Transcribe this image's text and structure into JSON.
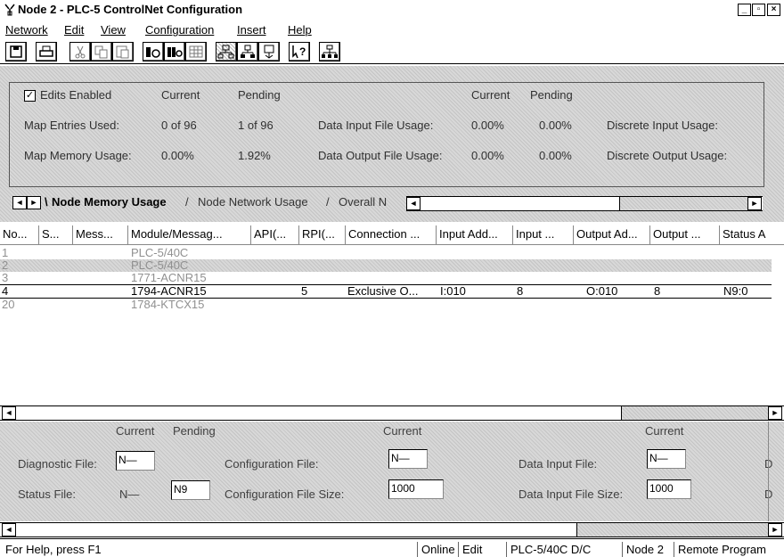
{
  "window": {
    "title": "Node 2 - PLC-5 ControlNet Configuration",
    "minimize_glyph": "_",
    "maximize_glyph": "▫",
    "close_glyph": "×"
  },
  "menu": [
    "Network",
    "Edit",
    "View",
    "Configuration",
    "Insert",
    "Help"
  ],
  "toolbar_icons": [
    "save-icon",
    "print-icon",
    "cut-icon",
    "copy-icon",
    "paste-icon",
    "io-icon",
    "multi-io-icon",
    "grid-icon",
    "network-tree-icon",
    "hierarchy-icon",
    "transfer-icon",
    "help-icon",
    "network-icon"
  ],
  "summary": {
    "edits_enabled_label": "Edits Enabled",
    "edits_enabled_checked": true,
    "checkbox_mark": "✓",
    "col_current": "Current",
    "col_pending": "Pending",
    "col_current2": "Current",
    "col_pending2": "Pending",
    "map_entries_label": "Map Entries Used:",
    "map_entries_current": "0 of 96",
    "map_entries_pending": "1 of 96",
    "map_memory_label": "Map Memory Usage:",
    "map_memory_current": "0.00%",
    "map_memory_pending": "1.92%",
    "data_input_label": "Data Input File Usage:",
    "data_input_current": "0.00%",
    "data_input_pending": "0.00%",
    "data_output_label": "Data Output File Usage:",
    "data_output_current": "0.00%",
    "data_output_pending": "0.00%",
    "discrete_input_label": "Discrete Input Usage:",
    "discrete_output_label": "Discrete Output Usage:"
  },
  "tabs": [
    "Node Memory Usage",
    "Node Network Usage",
    "Overall N"
  ],
  "scroll_glyphs": {
    "left": "◄",
    "right": "►"
  },
  "grid": {
    "columns": [
      "No...",
      "S...",
      "Mess...",
      "Module/Messag...",
      "API(...",
      "RPI(...",
      "Connection ...",
      "Input Add...",
      "Input ...",
      "Output Ad...",
      "Output ...",
      "Status A"
    ],
    "rows": [
      {
        "no": "1",
        "module": "PLC-5/40C",
        "rpi": "",
        "connection": "",
        "input_addr": "",
        "input_size": "",
        "output_addr": "",
        "output_size": "",
        "status": ""
      },
      {
        "no": "2",
        "module": "PLC-5/40C",
        "rpi": "",
        "connection": "",
        "input_addr": "",
        "input_size": "",
        "output_addr": "",
        "output_size": "",
        "status": ""
      },
      {
        "no": "3",
        "module": "1771-ACNR15",
        "rpi": "",
        "connection": "",
        "input_addr": "",
        "input_size": "",
        "output_addr": "",
        "output_size": "",
        "status": ""
      },
      {
        "no": "4",
        "module": "1794-ACNR15",
        "rpi": "5",
        "connection": "Exclusive O...",
        "input_addr": "I:010",
        "input_size": "8",
        "output_addr": "O:010",
        "output_size": "8",
        "status": "N9:0"
      },
      {
        "no": "20",
        "module": "1784-KTCX15",
        "rpi": "",
        "connection": "",
        "input_addr": "",
        "input_size": "",
        "output_addr": "",
        "output_size": "",
        "status": ""
      }
    ]
  },
  "lower": {
    "current_1": "Current",
    "pending_1": "Pending",
    "current_2": "Current",
    "current_3": "Current",
    "diagnostic_file_label": "Diagnostic File:",
    "diagnostic_file_current": "N—",
    "status_file_label": "Status File:",
    "status_file_current": "N—",
    "status_file_pending": "N9",
    "configuration_file_label": "Configuration File:",
    "configuration_file_current": "N—",
    "configuration_file_size_label": "Configuration File Size:",
    "configuration_file_size_current": "1000",
    "data_input_file_label": "Data Input File:",
    "data_input_file_current": "N—",
    "data_input_file_size_label": "Data Input File Size:",
    "data_input_file_size_current": "1000",
    "cut_char_1": "D",
    "cut_char_2": "D"
  },
  "status_bar": {
    "help": "For Help, press F1",
    "online": "Online",
    "mode": "Edit",
    "processor": "PLC-5/40C D/C",
    "node": "Node 2",
    "state": "Remote Program"
  }
}
